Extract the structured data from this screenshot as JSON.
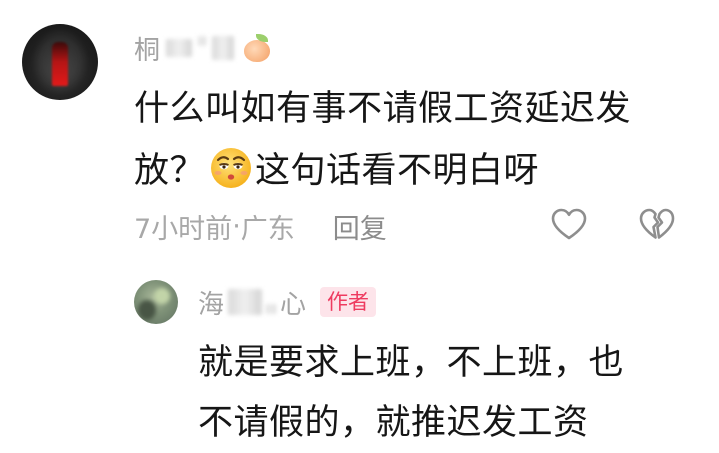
{
  "comment": {
    "username_prefix": "桐",
    "username_mid": "·",
    "text_line1": "什么叫如有事不请假工资延迟发",
    "text_line2a": "放？",
    "text_line2b": "这句话看不明白呀",
    "emoji": "squinting-face-emoji",
    "time": "7小时前",
    "separator": " · ",
    "location": "广东",
    "reply_label": "回复"
  },
  "reply": {
    "username_prefix": "海",
    "username_suffix": "心",
    "author_badge": "作者",
    "text_line1": "就是要求上班，不上班，也",
    "text_line2": "不请假的，就推迟发工资"
  },
  "icons": {
    "like": "heart-outline-icon",
    "dislike": "broken-heart-outline-icon",
    "badge_emoji": "peach-icon"
  },
  "colors": {
    "text": "#161616",
    "meta": "#a8a8a8",
    "author_badge_bg": "#fde4ea",
    "author_badge_fg": "#ee3b60"
  }
}
